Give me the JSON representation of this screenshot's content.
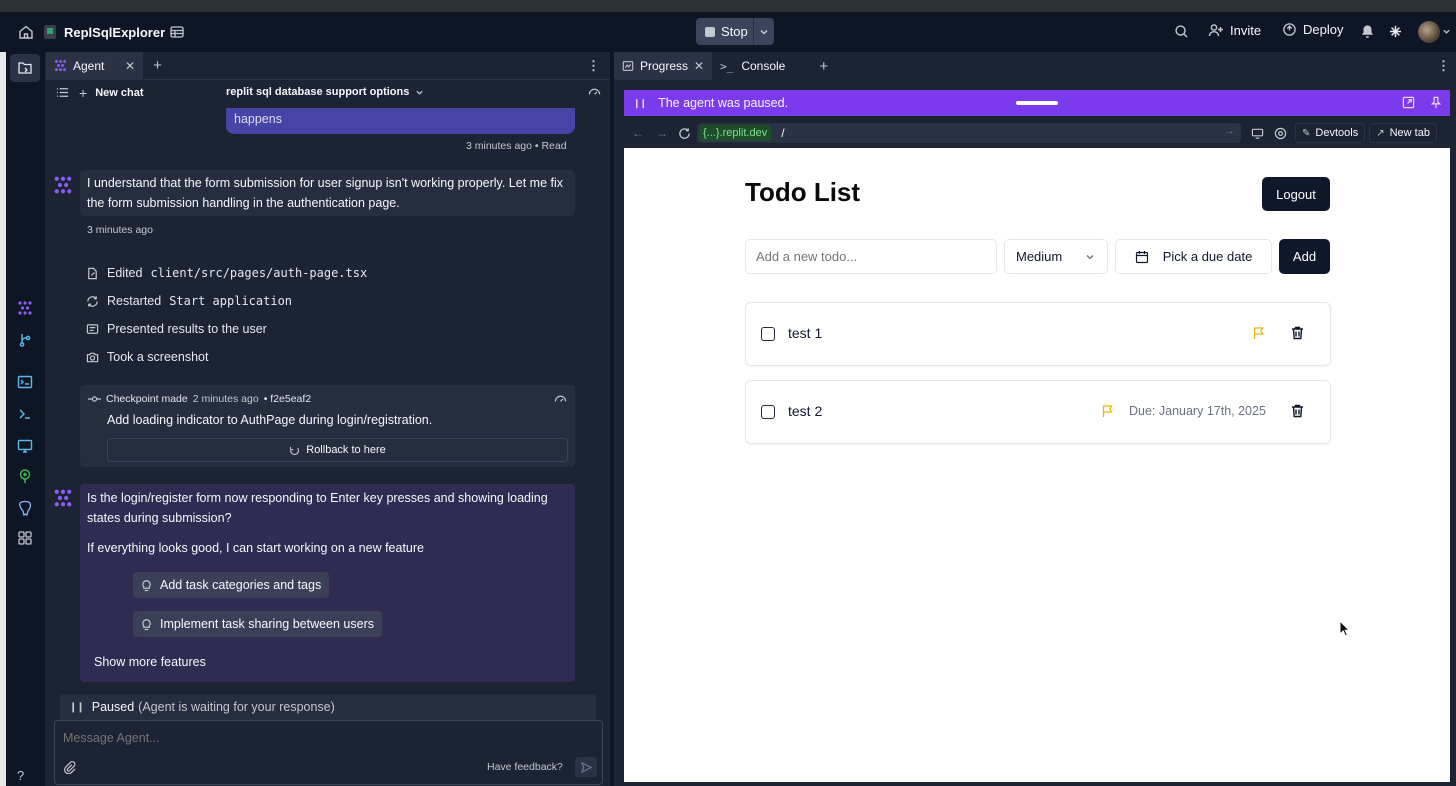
{
  "header": {
    "project_name": "ReplSqlExplorer",
    "stop_label": "Stop",
    "invite_label": "Invite",
    "deploy_label": "Deploy"
  },
  "agent_pane": {
    "tab_label": "Agent",
    "new_chat_label": "New chat",
    "chat_title": "replit sql database support options",
    "prev_user_message_tail": "happens",
    "prev_user_meta": "3 minutes ago • Read",
    "agent_message": "I understand that the form submission for user signup isn't working properly. Let me fix the form submission handling in the authentication page.",
    "agent_message_time": "3 minutes ago",
    "actions": [
      {
        "label": "Edited",
        "code": "client/src/pages/auth-page.tsx",
        "icon": "edit-file-icon"
      },
      {
        "label": "Restarted",
        "code": "Start application",
        "icon": "restart-icon"
      },
      {
        "label": "Presented results to the user",
        "code": "",
        "icon": "presentation-icon"
      },
      {
        "label": "Took a screenshot",
        "code": "",
        "icon": "camera-icon"
      }
    ],
    "checkpoint": {
      "label": "Checkpoint made",
      "time": "2 minutes ago",
      "hash": "• f2e5eaf2",
      "description": "Add loading indicator to AuthPage during login/registration.",
      "rollback_label": "Rollback to here"
    },
    "question": "Is the login/register form now responding to Enter key presses and showing loading states during submission?",
    "followup": "If everything looks good, I can start working on a new feature",
    "suggestions": [
      "Add task categories and tags",
      "Implement task sharing between users"
    ],
    "show_more_label": "Show more features",
    "paused_label": "Paused",
    "paused_detail": "(Agent is waiting for your response)",
    "input_placeholder": "Message Agent...",
    "feedback_label": "Have feedback?"
  },
  "right_pane": {
    "tabs": [
      {
        "label": "Progress"
      },
      {
        "label": "Console"
      }
    ],
    "paused_banner": "The agent was paused.",
    "url_host": "{...}.replit.dev",
    "url_path": "/",
    "devtools_label": "Devtools",
    "new_tab_label": "New tab"
  },
  "app": {
    "title": "Todo List",
    "logout_label": "Logout",
    "new_todo_placeholder": "Add a new todo...",
    "priority_value": "Medium",
    "due_date_label": "Pick a due date",
    "add_label": "Add",
    "todos": [
      {
        "title": "test 1",
        "due": "",
        "flag_color": "#eab308"
      },
      {
        "title": "test 2",
        "due": "Due: January 17th, 2025",
        "flag_color": "#eab308"
      }
    ]
  },
  "colors": {
    "accent_purple": "#7c3aed",
    "app_dark": "#0f172a",
    "bg_dark": "#0e1525",
    "panel": "#1c2333"
  }
}
